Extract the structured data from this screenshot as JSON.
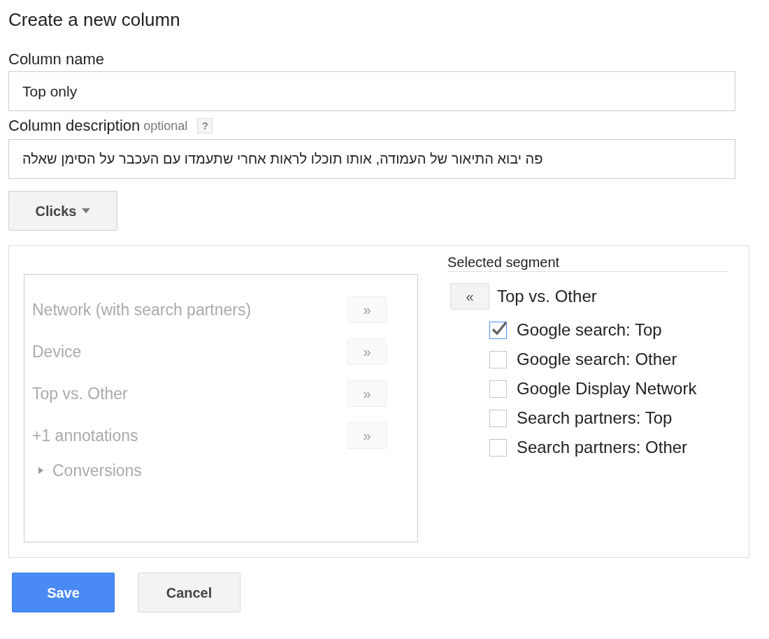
{
  "title": "Create a new column",
  "column_name": {
    "label": "Column name",
    "value": "Top only"
  },
  "column_description": {
    "label": "Column description",
    "hint": "optional",
    "help": "?",
    "value": "פה יבוא התיאור של העמודה, אותו תוכלו לראות אחרי שתעמדו עם העכבר על הסימן שאלה"
  },
  "metric_dropdown": {
    "label": "Clicks"
  },
  "segments": [
    {
      "kind": "segment",
      "label": "Network (with search partners)",
      "button": "»",
      "disabled": true
    },
    {
      "kind": "segment",
      "label": "Device",
      "button": "»",
      "disabled": true
    },
    {
      "kind": "segment",
      "label": "Top vs. Other",
      "button": "»",
      "disabled": true
    },
    {
      "kind": "segment",
      "label": "+1 annotations",
      "button": "»",
      "disabled": true
    },
    {
      "kind": "group",
      "label": "Conversions",
      "expanded": false,
      "disabled": true
    }
  ],
  "selected_segment": {
    "heading": "Selected segment",
    "remove_button": "«",
    "name": "Top vs. Other",
    "options": [
      {
        "label": "Google search: Top",
        "checked": true
      },
      {
        "label": "Google search: Other",
        "checked": false
      },
      {
        "label": "Google Display Network",
        "checked": false
      },
      {
        "label": "Search partners: Top",
        "checked": false
      },
      {
        "label": "Search partners: Other",
        "checked": false
      }
    ]
  },
  "buttons": [
    {
      "kind": "primary",
      "label": "Save"
    },
    {
      "kind": "secondary",
      "label": "Cancel"
    }
  ]
}
